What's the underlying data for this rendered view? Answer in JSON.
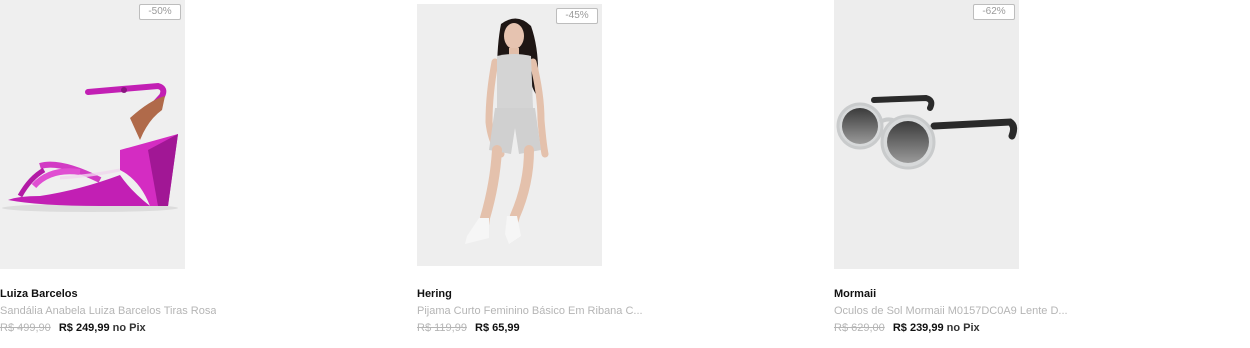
{
  "products": [
    {
      "badge": "-50%",
      "brand": "Luiza Barcelos",
      "title": "Sandália Anabela Luiza Barcelos Tiras Rosa",
      "old_price": "R$ 499,90",
      "new_price": "R$ 249,99",
      "pix_label": "no Pix",
      "image_icon": "pink-wedge-sandal-image",
      "accent": "#c21fb4"
    },
    {
      "badge": "-45%",
      "brand": "Hering",
      "title": "Pijama Curto Feminino Básico Em Ribana C...",
      "old_price": "R$ 119,99",
      "new_price": "R$ 65,99",
      "pix_label": "",
      "image_icon": "model-gray-pajama-image",
      "accent": "#d9d9d9"
    },
    {
      "badge": "-62%",
      "brand": "Mormaii",
      "title": "Oculos de Sol Mormaii M0157DC0A9 Lente D...",
      "old_price": "R$ 629,00",
      "new_price": "R$ 239,99",
      "pix_label": "no Pix",
      "image_icon": "round-sunglasses-image",
      "accent": "#2a2a2a"
    }
  ]
}
